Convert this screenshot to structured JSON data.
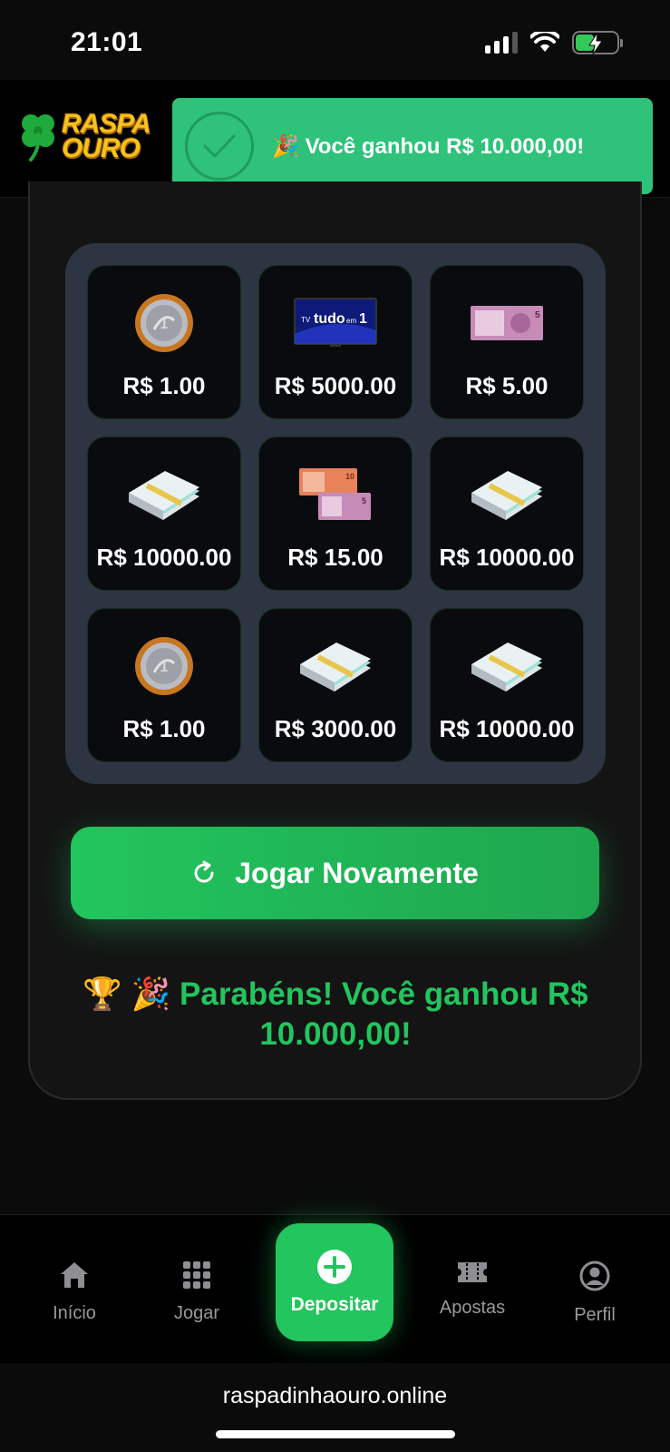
{
  "status_bar": {
    "time": "21:01"
  },
  "header": {
    "logo_line1": "RASPA",
    "logo_line2": "OURO"
  },
  "toast": {
    "emoji": "🎉",
    "message": "Você ganhou R$ 10.000,00!",
    "color": "#2fc27a"
  },
  "grid": {
    "cells": [
      {
        "icon": "coin-icon",
        "label": "R$ 1.00"
      },
      {
        "icon": "tv-icon",
        "label": "R$ 5000.00",
        "tv_text": "tudo",
        "tv_small1": "TV",
        "tv_small2": "em",
        "tv_num": "1"
      },
      {
        "icon": "banknote-5-icon",
        "label": "R$ 5.00",
        "note_value": "5"
      },
      {
        "icon": "cash-stack-icon",
        "label": "R$ 10000.00"
      },
      {
        "icon": "banknotes-10-5-icon",
        "label": "R$ 15.00",
        "note_value_a": "10",
        "note_value_b": "5"
      },
      {
        "icon": "cash-stack-icon",
        "label": "R$ 10000.00"
      },
      {
        "icon": "coin-icon",
        "label": "R$ 1.00"
      },
      {
        "icon": "cash-stack-icon",
        "label": "R$ 3000.00"
      },
      {
        "icon": "cash-stack-icon",
        "label": "R$ 10000.00"
      }
    ]
  },
  "play_again": {
    "label": "Jogar Novamente"
  },
  "congrats": {
    "emoji": "🏆 🎉",
    "message": "Parabéns! Você ganhou R$ 10.000,00!"
  },
  "bottom_nav": {
    "items": [
      {
        "label": "Início",
        "icon": "home-icon"
      },
      {
        "label": "Jogar",
        "icon": "grid-icon"
      },
      {
        "label": "Depositar",
        "icon": "plus-circle-icon"
      },
      {
        "label": "Apostas",
        "icon": "ticket-icon"
      },
      {
        "label": "Perfil",
        "icon": "user-icon"
      }
    ]
  },
  "browser": {
    "url": "raspadinhaouro.online"
  },
  "colors": {
    "accent": "#22c55e",
    "grid_bg": "#2d3442",
    "cell_bg": "#0a0b0e"
  }
}
